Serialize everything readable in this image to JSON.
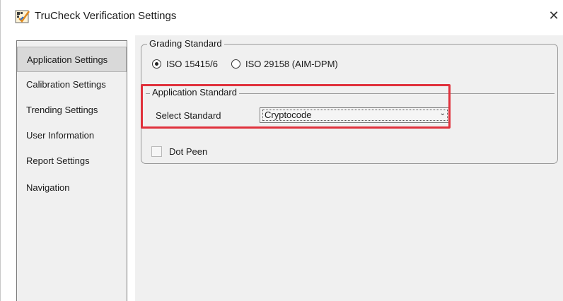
{
  "window": {
    "title": "TruCheck Verification Settings",
    "close_glyph": "✕",
    "app_icon": "trucheck-app-icon"
  },
  "sidebar": {
    "items": [
      {
        "label": "Application Settings",
        "selected": true
      },
      {
        "label": "Calibration Settings",
        "selected": false
      },
      {
        "label": "Trending Settings",
        "selected": false
      },
      {
        "label": "User Information",
        "selected": false
      },
      {
        "label": "Report Settings",
        "selected": false
      },
      {
        "label": "Navigation",
        "selected": false
      }
    ]
  },
  "grading": {
    "legend": "Grading Standard",
    "options": [
      {
        "label": "ISO 15415/6",
        "checked": true
      },
      {
        "label": "ISO 29158 (AIM-DPM)",
        "checked": false
      }
    ]
  },
  "application": {
    "legend": "Application Standard",
    "select_label": "Select Standard",
    "selected_value": "Cryptocode",
    "dot_peen_label": "Dot Peen",
    "dot_peen_checked": false
  },
  "colors": {
    "highlight": "#e0313c",
    "panel_bg": "#f0f0f0"
  }
}
